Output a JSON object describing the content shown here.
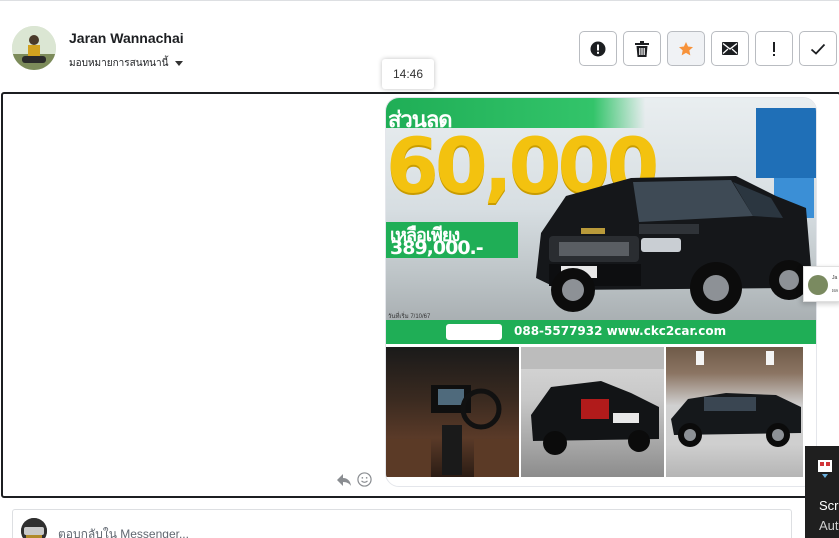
{
  "header": {
    "user_name": "Jaran Wannachai",
    "assign_label": "มอบหมายการสนทนานี้"
  },
  "actions": [
    {
      "name": "spam",
      "icon": "alert-circle-icon"
    },
    {
      "name": "delete",
      "icon": "trash-icon"
    },
    {
      "name": "star",
      "icon": "star-icon",
      "color": "#f7923a"
    },
    {
      "name": "unread",
      "icon": "envelope-icon"
    },
    {
      "name": "important",
      "icon": "exclamation-icon"
    },
    {
      "name": "done",
      "icon": "check-icon"
    }
  ],
  "message": {
    "timestamp": "14:46",
    "ad": {
      "discount_label": "ส่วนลด",
      "discount_amount": "60,000",
      "left_only_label": "เหลือเพียง",
      "price": "389,000.-",
      "date_tag": "วันที่เริ่ม 7/10/67",
      "contact": "088-5577932  www.ckc2car.com"
    },
    "reactions": [
      "reply-icon",
      "smiley-icon"
    ]
  },
  "popup": {
    "name": "Ja",
    "sub": "ผล"
  },
  "toast": {
    "line1": "Scr",
    "line2": "Aut"
  },
  "reply": {
    "placeholder": "ตอบกลับใน Messenger..."
  },
  "colors": {
    "accent_green": "#1fae56",
    "price_yellow": "#f3c20f",
    "star_orange": "#f7923a"
  }
}
